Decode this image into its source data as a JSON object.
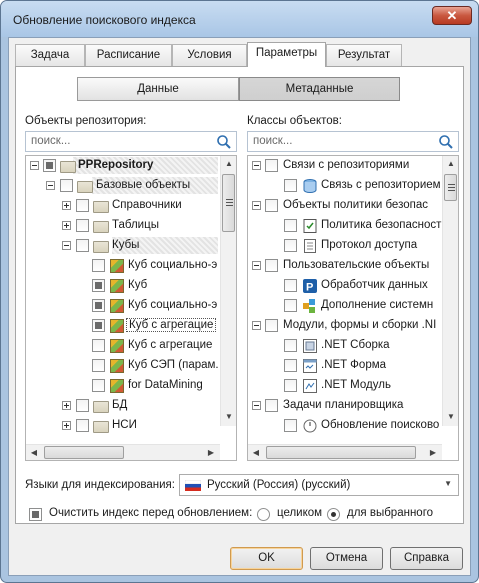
{
  "window": {
    "title": "Обновление поискового индекса",
    "close_label": "✕"
  },
  "tabs": [
    {
      "label": "Задача"
    },
    {
      "label": "Расписание"
    },
    {
      "label": "Условия"
    },
    {
      "label": "Параметры"
    },
    {
      "label": "Результат"
    }
  ],
  "segment": {
    "data_label": "Данные",
    "meta_label": "Метаданные"
  },
  "left": {
    "header": "Объекты репозитория:",
    "search_placeholder": "поиск...",
    "items": [
      {
        "label": "PPRepository"
      },
      {
        "label": "Базовые объекты"
      },
      {
        "label": "Справочники"
      },
      {
        "label": "Таблицы"
      },
      {
        "label": "Кубы"
      },
      {
        "label": "Куб социально-э"
      },
      {
        "label": "Куб"
      },
      {
        "label": "Куб социально-э"
      },
      {
        "label": "Куб с агрегацие"
      },
      {
        "label": "Куб с агрегацие"
      },
      {
        "label": "Куб СЭП (парам."
      },
      {
        "label": "for DataMining"
      },
      {
        "label": "БД"
      },
      {
        "label": "НСИ"
      }
    ]
  },
  "right": {
    "header": "Классы объектов:",
    "search_placeholder": "поиск...",
    "items": [
      {
        "label": "Связи с репозиториями"
      },
      {
        "label": "Связь с репозиторием"
      },
      {
        "label": "Объекты политики безопас"
      },
      {
        "label": "Политика безопасност"
      },
      {
        "label": "Протокол доступа"
      },
      {
        "label": "Пользовательские объекты"
      },
      {
        "label": "Обработчик данных"
      },
      {
        "label": "Дополнение системн"
      },
      {
        "label": "Модули, формы и сборки .NI"
      },
      {
        "label": ".NET Сборка"
      },
      {
        "label": ".NET Форма"
      },
      {
        "label": ".NET Модуль"
      },
      {
        "label": "Задачи планировщика"
      },
      {
        "label": "Обновление поисково"
      }
    ]
  },
  "languages": {
    "label": "Языки для индексирования:",
    "value": "Русский (Россия) (русский)"
  },
  "clear": {
    "label": "Очистить индекс перед обновлением:",
    "opt_all": "целиком",
    "opt_selected": "для выбранного"
  },
  "buttons": {
    "ok": "OK",
    "cancel": "Отмена",
    "help": "Справка"
  }
}
